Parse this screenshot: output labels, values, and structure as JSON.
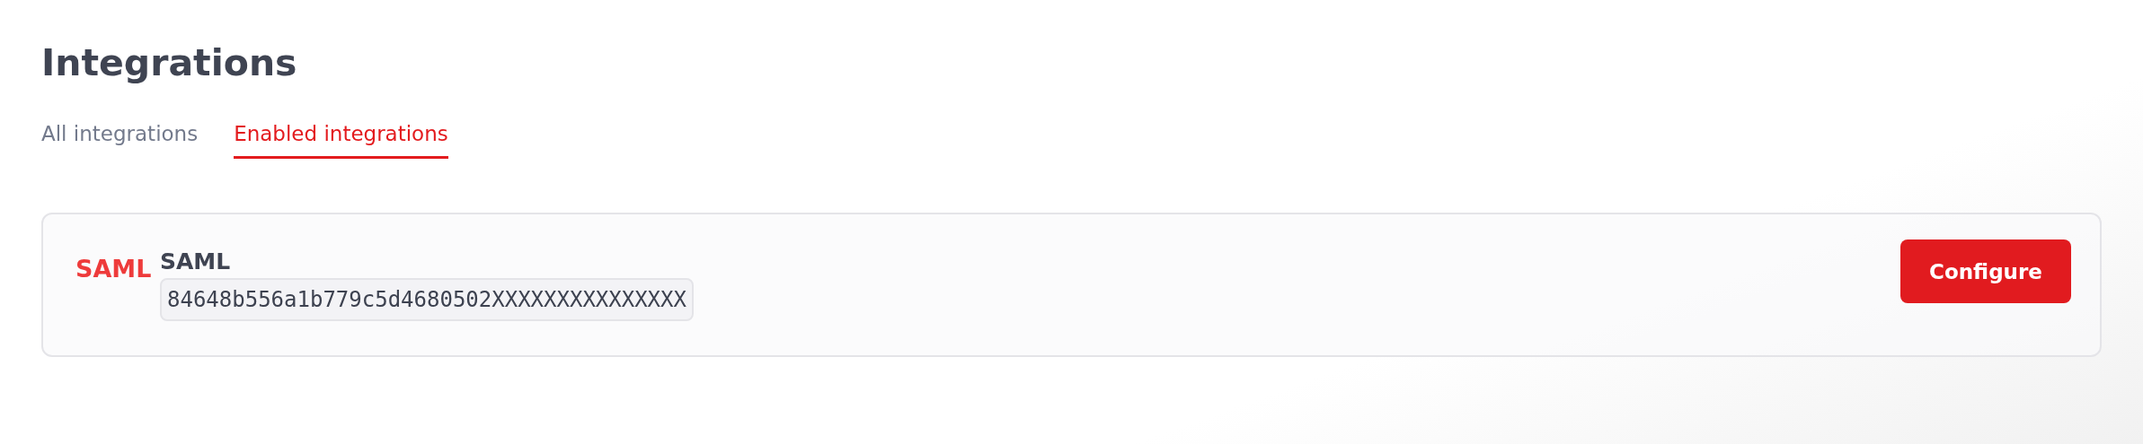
{
  "page": {
    "title": "Integrations"
  },
  "tabs": [
    {
      "label": "All integrations",
      "selected": false
    },
    {
      "label": "Enabled integrations",
      "selected": true
    }
  ],
  "integrations": [
    {
      "logo_text": "SAML",
      "name": "SAML",
      "key": "84648b556a1b779c5d4680502XXXXXXXXXXXXXXX",
      "button": "Configure"
    }
  ]
}
